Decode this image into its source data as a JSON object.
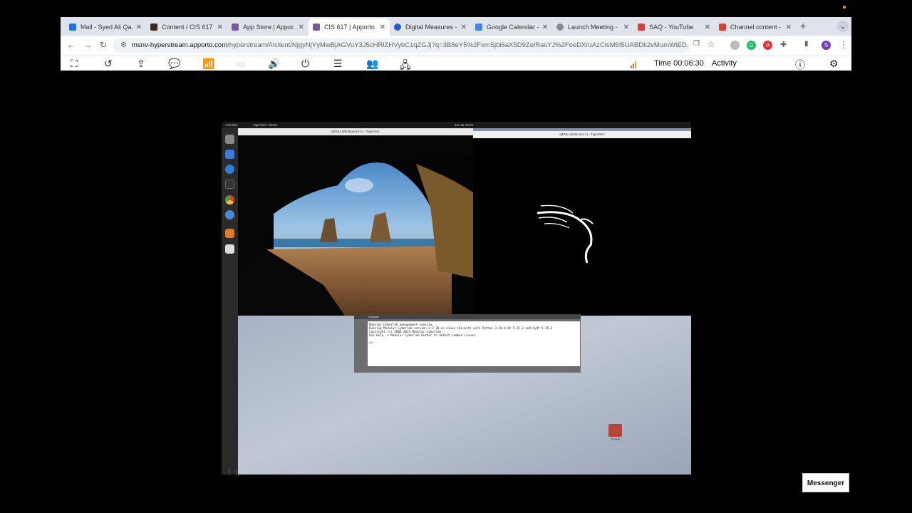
{
  "tabs": [
    {
      "label": "Mail - Syed Ali Qa...",
      "color": "#1a73e8"
    },
    {
      "label": "Content / CIS 617 ...",
      "color": "#3a2a1a"
    },
    {
      "label": "App Store | Appor...",
      "color": "#7a5a9a"
    },
    {
      "label": "CIS 617 | Apporto",
      "color": "#7a5a9a",
      "active": true
    },
    {
      "label": "Digital Measures -",
      "color": "#2a5bd7"
    },
    {
      "label": "Google Calendar -",
      "color": "#4285f4"
    },
    {
      "label": "Launch Meeting -",
      "color": "#888888"
    },
    {
      "label": "SAQ - YouTube",
      "color": "#e53935"
    },
    {
      "label": "Channel content -",
      "color": "#e53935"
    }
  ],
  "address": {
    "host": "msnv-hyperstream.apporto.com",
    "path": "/hyperstream/#/client/NjgyNjYyMwBjAGVuY3J5cHRlZHVybC1qZGJj?q=3B8eY5%2FxmSjbi6aX5D9ZelRasYJ%2FoeDXruAzClsM5f5UABDk2vMumWtED..."
  },
  "toolbar": {
    "time_label": "Time 00:06:30",
    "activity_label": "Activity"
  },
  "remote": {
    "gnome_activities": "Activities",
    "gnome_app": "TigerVNC Viewer",
    "gnome_clock": "Jan 18  18:23",
    "win_title": "QEMU (Windows10-1) - TigerVNC",
    "kali_title": "QEMU (KaliLinux-1) - TigerVNC",
    "console_title": "Console",
    "console_lines": [
      "Modular Cyberlab management console.",
      "Running Modular Cyberlab version 2.2.38 on Linux (64-bit) with Python 3.10.6 Qt 5.15.3 and PyQt 5.15.6",
      "Copyright (c) 2006-2024 Modular Cyberlab.",
      "Use Help -> Modular Cyberlab Doctor to detect common issues.",
      "",
      "=>"
    ],
    "home_label": "Home"
  },
  "messenger_label": "Messenger"
}
